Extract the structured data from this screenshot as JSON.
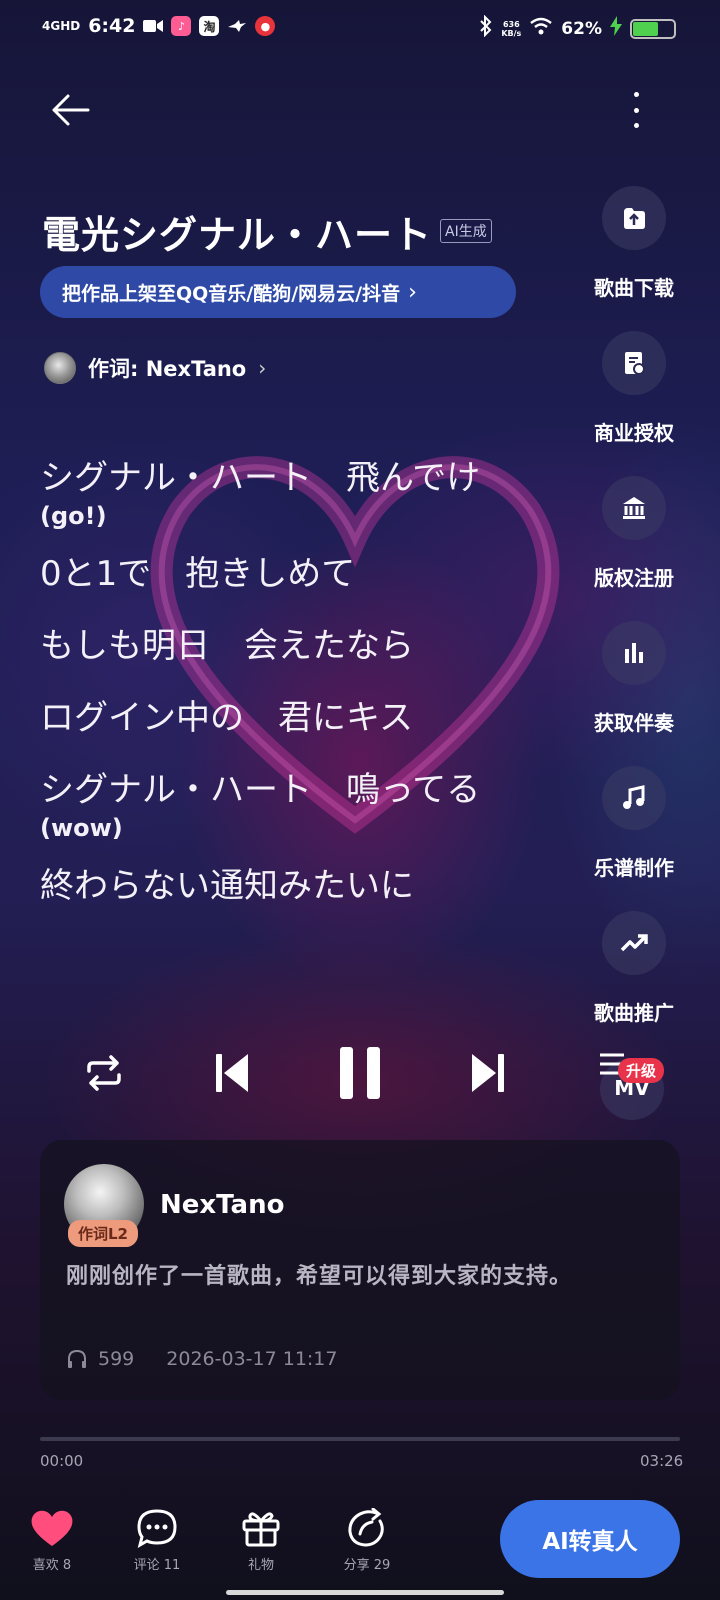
{
  "status_bar": {
    "network": "4GHD",
    "time": "6:42",
    "app_icons": [
      "video-camera-icon",
      "app-icon-pink",
      "taobao-icon",
      "bird-icon",
      "app-icon-red"
    ],
    "speed_value": "636",
    "speed_unit": "KB/s",
    "battery_text": "62%",
    "battery_level_percent": 62
  },
  "header": {
    "back_icon": "arrow-left-icon",
    "more_icon": "more-vertical-icon"
  },
  "song": {
    "title": "電光シグナル・ハート",
    "ai_tag": "AI生成",
    "publish_text": "把作品上架至QQ音乐/酷狗/网易云/抖音",
    "publish_chevron": "›",
    "lyricist_label": "作词: NexTano",
    "lyricist_chevron": "›"
  },
  "lyrics": {
    "line1": "シグナル・ハート　飛んでけ",
    "line1_sub": "(go!)",
    "line2": "0と1で　抱きしめて",
    "line3": "もしも明日　会えたなら",
    "line4": "ログイン中の　君にキス",
    "line5": "シグナル・ハート　鳴ってる",
    "line5_sub": "(wow)",
    "line6": "終わらない通知みたいに"
  },
  "side_actions": [
    {
      "label": "歌曲下载",
      "icon": "download-cloud-icon"
    },
    {
      "label": "商业授权",
      "icon": "license-doc-icon"
    },
    {
      "label": "版权注册",
      "icon": "institution-icon"
    },
    {
      "label": "获取伴奏",
      "icon": "audio-bars-icon"
    },
    {
      "label": "乐谱制作",
      "icon": "music-note-icon"
    },
    {
      "label": "歌曲推广",
      "icon": "trending-up-icon"
    }
  ],
  "player": {
    "repeat_icon": "repeat-icon",
    "prev_icon": "skip-previous-icon",
    "pause_icon": "pause-icon",
    "next_icon": "skip-next-icon",
    "playlist_icon": "playlist-icon",
    "mv_label": "MV",
    "upgrade_badge": "升级"
  },
  "post_card": {
    "author": "NexTano",
    "badge": "作词L2",
    "description": "刚刚创作了一首歌曲，希望可以得到大家的支持。",
    "plays": "599",
    "datetime": "2026-03-17  11:17"
  },
  "progress": {
    "current": "00:00",
    "total": "03:26",
    "fraction": 0.0
  },
  "bottom_bar": {
    "like": "喜欢 8",
    "comment": "评论 11",
    "gift": "礼物",
    "share": "分享 29",
    "ai_button": "AI转真人",
    "like_color": "#ff4d7d",
    "ai_button_color": "#3b74e6"
  }
}
